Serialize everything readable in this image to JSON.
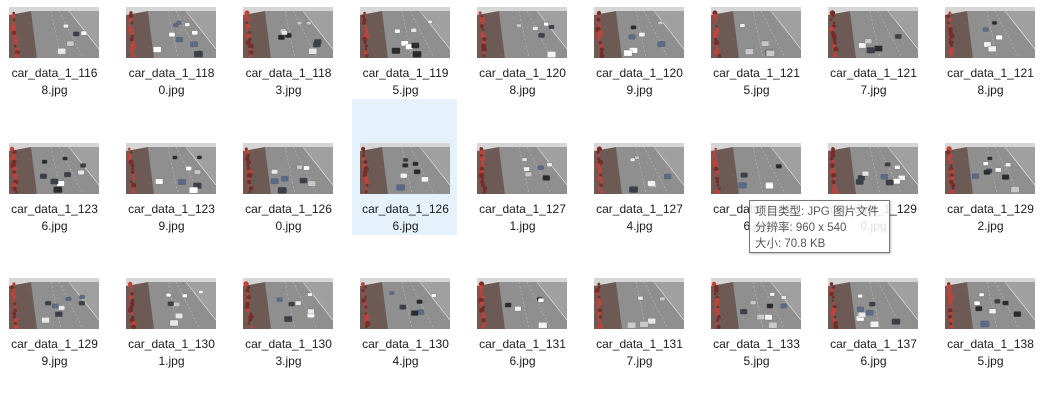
{
  "files": [
    [
      "car_data_1_116",
      "8.jpg"
    ],
    [
      "car_data_1_118",
      "0.jpg"
    ],
    [
      "car_data_1_118",
      "3.jpg"
    ],
    [
      "car_data_1_119",
      "5.jpg"
    ],
    [
      "car_data_1_120",
      "8.jpg"
    ],
    [
      "car_data_1_120",
      "9.jpg"
    ],
    [
      "car_data_1_121",
      "5.jpg"
    ],
    [
      "car_data_1_121",
      "7.jpg"
    ],
    [
      "car_data_1_121",
      "8.jpg"
    ],
    [
      "car_data_1_123",
      "6.jpg"
    ],
    [
      "car_data_1_123",
      "9.jpg"
    ],
    [
      "car_data_1_126",
      "0.jpg"
    ],
    [
      "car_data_1_126",
      "6.jpg"
    ],
    [
      "car_data_1_127",
      "1.jpg"
    ],
    [
      "car_data_1_127",
      "4.jpg"
    ],
    [
      "car_data_1_127",
      "6.jpg"
    ],
    [
      "car_data_1_129",
      "0.jpg"
    ],
    [
      "car_data_1_129",
      "2.jpg"
    ],
    [
      "car_data_1_129",
      "9.jpg"
    ],
    [
      "car_data_1_130",
      "1.jpg"
    ],
    [
      "car_data_1_130",
      "3.jpg"
    ],
    [
      "car_data_1_130",
      "4.jpg"
    ],
    [
      "car_data_1_131",
      "6.jpg"
    ],
    [
      "car_data_1_131",
      "7.jpg"
    ],
    [
      "car_data_1_133",
      "5.jpg"
    ],
    [
      "car_data_1_137",
      "6.jpg"
    ],
    [
      "car_data_1_138",
      "5.jpg"
    ]
  ],
  "selected_index": 12,
  "tooltip": {
    "type_line": "项目类型: JPG 图片文件",
    "dimensions_line": "分辨率: 960 x 540",
    "size_line": "大小: 70.8 KB"
  },
  "colors": {
    "selection_bg": "#e5f1fb",
    "road": "#8a8a8a",
    "sky": "#d6d6d6",
    "roadside": "#b03a35"
  },
  "thumbnail_icon": "road-traffic-photo"
}
